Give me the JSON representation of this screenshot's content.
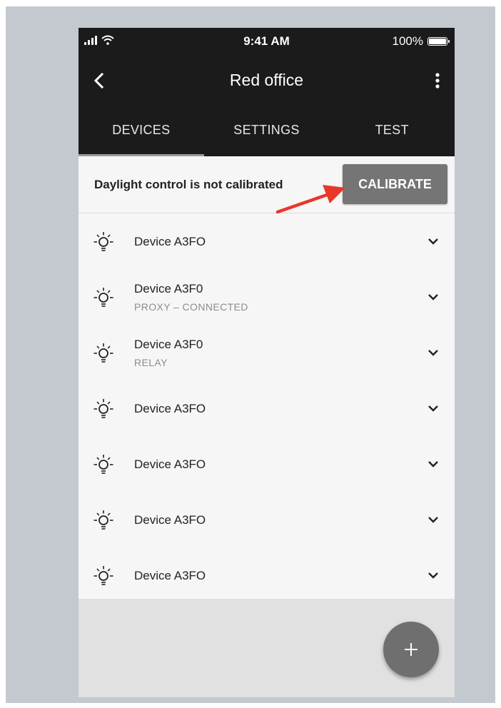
{
  "status_bar": {
    "time": "9:41 AM",
    "battery": "100%"
  },
  "app_bar": {
    "title": "Red office"
  },
  "tabs": [
    {
      "label": "DEVICES",
      "active": true
    },
    {
      "label": "SETTINGS",
      "active": false
    },
    {
      "label": "TEST",
      "active": false
    }
  ],
  "calibration": {
    "message": "Daylight control is not calibrated",
    "button_label": "CALIBRATE"
  },
  "devices": [
    {
      "name": "Device A3FO",
      "subtitle": ""
    },
    {
      "name": "Device A3F0",
      "subtitle": "PROXY – CONNECTED"
    },
    {
      "name": "Device A3F0",
      "subtitle": "RELAY"
    },
    {
      "name": "Device A3FO",
      "subtitle": ""
    },
    {
      "name": "Device A3FO",
      "subtitle": ""
    },
    {
      "name": "Device A3FO",
      "subtitle": ""
    },
    {
      "name": "Device A3FO",
      "subtitle": ""
    }
  ],
  "icons": {
    "back": "back-arrow-icon",
    "more": "more-vert-icon",
    "device": "light-bulb-icon",
    "expand": "chevron-down-icon",
    "add": "plus-icon"
  },
  "colors": {
    "header": "#1b1b1b",
    "calibrate_button": "#757575",
    "annotation_arrow": "#e8382a",
    "fab": "#6f6f6f"
  }
}
